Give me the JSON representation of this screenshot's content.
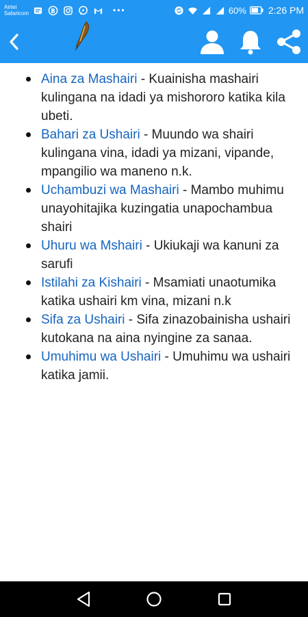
{
  "status_bar": {
    "carrier_line1": "Airtel",
    "carrier_line2": "Safaricom",
    "battery": "60%",
    "time": "2:26 PM",
    "dots": "•••"
  },
  "app_bar": {
    "back_icon": "chevron-left-icon",
    "logo_icon": "quill-pen-icon",
    "actions": [
      "profile-icon",
      "bell-icon",
      "share-icon"
    ]
  },
  "topics": [
    {
      "link": "Aina za Mashairi",
      "desc": " - Kuainisha mashairi kulingana na idadi ya mishororo katika kila ubeti."
    },
    {
      "link": "Bahari za Ushairi",
      "desc": " - Muundo wa shairi kulingana vina, idadi ya mizani, vipande, mpangilio wa maneno n.k."
    },
    {
      "link": "Uchambuzi wa Mashairi",
      "desc": " - Mambo muhimu unayohitajika kuzingatia unapochambua shairi"
    },
    {
      "link": "Uhuru wa Mshairi",
      "desc": " - Ukiukaji wa kanuni za sarufi"
    },
    {
      "link": "Istilahi za Kishairi",
      "desc": " - Msamiati unaotumika katika ushairi km vina, mizani n.k"
    },
    {
      "link": "Sifa za Ushairi",
      "desc": " - Sifa zinazobainisha ushairi kutokana na aina nyingine za sanaa."
    },
    {
      "link": "Umuhimu wa Ushairi",
      "desc": " - Umuhimu wa ushairi katika jamii."
    }
  ],
  "colors": {
    "primary": "#2196f3",
    "link": "#1565c0",
    "text": "#222222"
  },
  "nav_bar": [
    "back-triangle-icon",
    "home-circle-icon",
    "recents-square-icon"
  ]
}
